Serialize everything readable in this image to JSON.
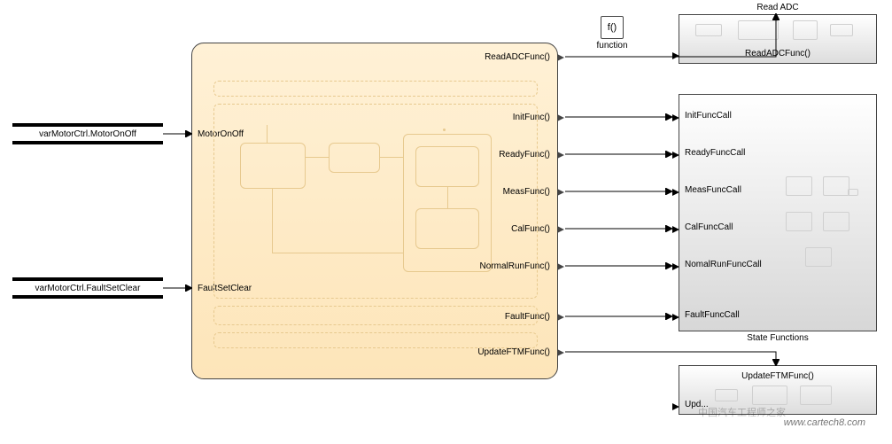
{
  "inputs": {
    "motorOnOff": "varMotorCtrl.MotorOnOff",
    "faultSetClear": "varMotorCtrl.FaultSetClear"
  },
  "chart": {
    "inPorts": {
      "motorOnOff": "MotorOnOff",
      "faultSetClear": "FaultSetClear"
    },
    "outPorts": {
      "readAdc": "ReadADCFunc()",
      "init": "InitFunc()",
      "ready": "ReadyFunc()",
      "meas": "MeasFunc()",
      "cal": "CalFunc()",
      "normal": "NormalRunFunc()",
      "fault": "FaultFunc()",
      "updateFtm": "UpdateFTMFunc()"
    }
  },
  "fnIcon": {
    "glyph": "f()",
    "label": "function"
  },
  "readAdc": {
    "title": "Read ADC",
    "port": "ReadADCFunc()"
  },
  "stateFns": {
    "title": "State Functions",
    "ports": {
      "init": "InitFuncCall",
      "ready": "ReadyFuncCall",
      "meas": "MeasFuncCall",
      "cal": "CalFuncCall",
      "normal": "NomalRunFuncCall",
      "fault": "FaultFuncCall"
    }
  },
  "updateFtm": {
    "title": "UpdateFTMFunc()",
    "portLabel": "Upd..."
  },
  "watermark": {
    "site": "www.cartech8.com",
    "cn": "中国汽车工程师之家"
  }
}
